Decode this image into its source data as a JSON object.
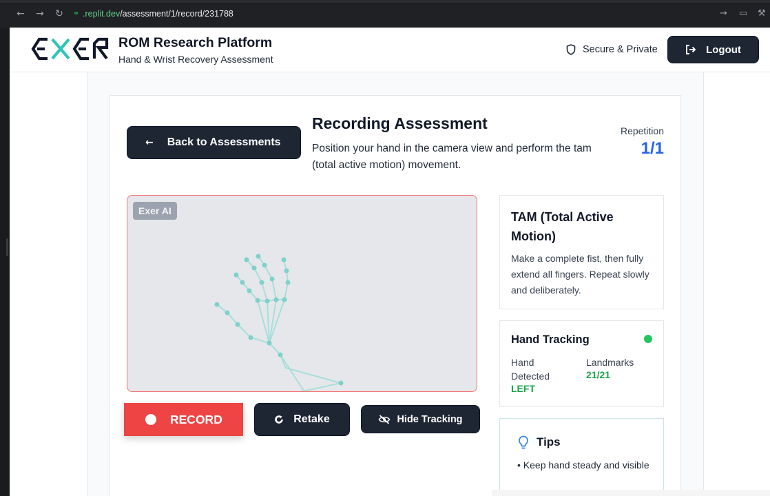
{
  "browser": {
    "url_host": ".replit.dev",
    "url_path": "/assessment/1/record/231788"
  },
  "header": {
    "brand_title": "ROM Research Platform",
    "brand_subtitle": "Hand & Wrist Recovery Assessment",
    "secure_label": "Secure & Private",
    "logout_label": "Logout"
  },
  "assessment": {
    "back_label": "Back to Assessments",
    "title": "Recording Assessment",
    "description": "Position your hand in the camera view and perform the tam (total active motion) movement.",
    "repetition_label": "Repetition",
    "repetition_value": "1/1"
  },
  "camera": {
    "badge": "Exer AI",
    "tracking_color": "#8ed8d2"
  },
  "controls": {
    "record_label": "RECORD",
    "retake_label": "Retake",
    "hide_tracking_label": "Hide Tracking"
  },
  "tam_card": {
    "title": "TAM (Total Active Motion)",
    "description": "Make a complete fist, then fully extend all fingers. Repeat slowly and deliberately."
  },
  "tracking_card": {
    "title": "Hand Tracking",
    "status_color": "#22c55e",
    "hand_detected_label": "Hand Detected",
    "hand_detected_value": "LEFT",
    "landmarks_label": "Landmarks",
    "landmarks_value": "21/21"
  },
  "tips_card": {
    "title": "Tips",
    "items": [
      "• Keep hand steady and visible"
    ]
  },
  "colors": {
    "primary_dark": "#1e2533",
    "record_red": "#ef4444",
    "accent_blue": "#2563eb",
    "success_green": "#16a34a"
  }
}
